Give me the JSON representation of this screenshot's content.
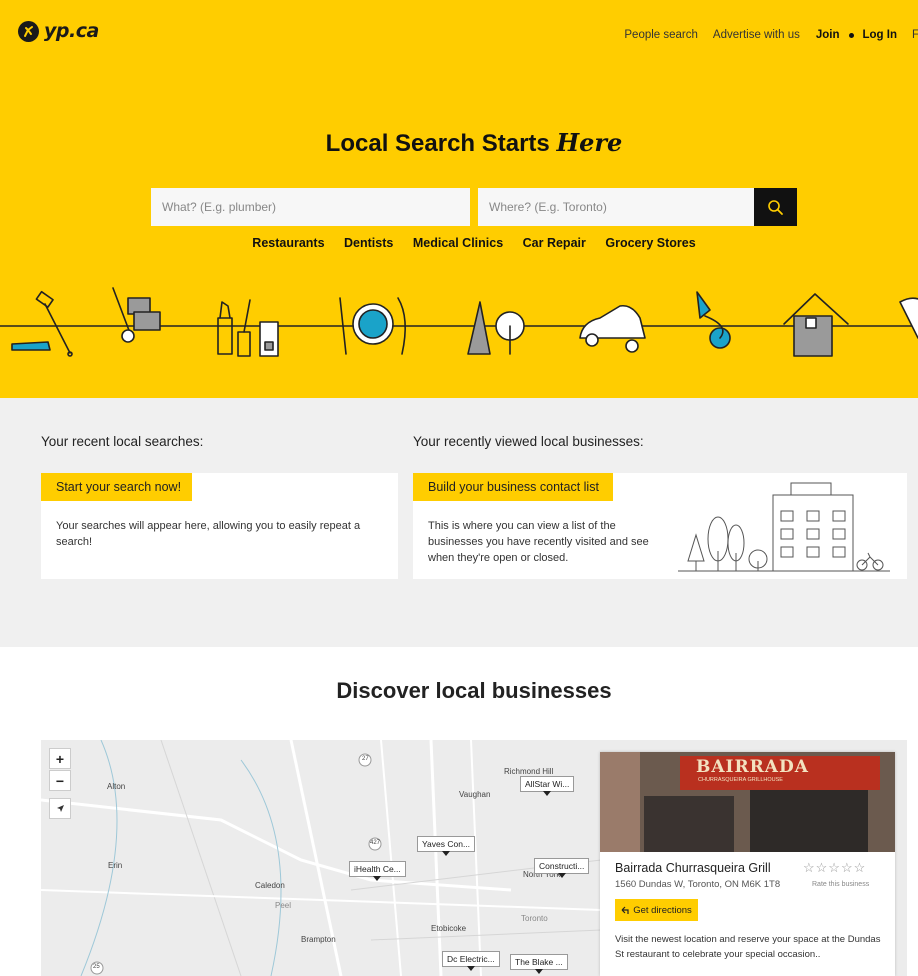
{
  "header": {
    "logo_text": "yp.ca",
    "nav": {
      "people_search": "People search",
      "advertise": "Advertise with us",
      "join": "Join",
      "login": "Log In",
      "clipped": "F"
    }
  },
  "hero": {
    "headline": "Local Search Starts",
    "headline_emphasis": "Here",
    "what_placeholder": "What? (E.g. plumber)",
    "where_placeholder": "Where? (E.g. Toronto)",
    "quick_links": [
      "Restaurants",
      "Dentists",
      "Medical Clinics",
      "Car Repair",
      "Grocery Stores"
    ]
  },
  "recent": {
    "searches_label": "Your recent local searches:",
    "searches_tag": "Start your search now!",
    "searches_text": "Your searches will appear here, allowing you to easily repeat a search!",
    "viewed_label": "Your recently viewed local businesses:",
    "viewed_tag": "Build your business contact list",
    "viewed_text": "This is where you can view a list of the businesses you have recently visited and see when they're open or closed."
  },
  "discover": {
    "title": "Discover local businesses",
    "zoom_in": "+",
    "zoom_out": "−",
    "map_places": [
      "Alton",
      "Richmond Hill",
      "Vaughan",
      "Erin",
      "Caledon",
      "Peel",
      "Brampton",
      "Etobicoke",
      "Toronto",
      "North York"
    ],
    "route_numbers": [
      "27",
      "427",
      "25"
    ],
    "map_pins": [
      "AllStar Wi...",
      "Yaves Con...",
      "iHealth Ce...",
      "Constructi...",
      "Dc Electric...",
      "The Blake ..."
    ],
    "business": {
      "sign_text": "BAIRRADA",
      "sign_subtext": "CHURRASQUEIRA GRILLHOUSE",
      "name": "Bairrada Churrasqueira Grill",
      "address": "1560 Dundas W, Toronto, ON M6K 1T8",
      "stars": "☆☆☆☆☆",
      "rate_label": "Rate this business",
      "directions_label": "Get directions",
      "description": "Visit the newest location and reserve your space at the Dundas St restaurant to celebrate your special occasion.."
    }
  },
  "colors": {
    "brand_yellow": "#ffcd00",
    "dark": "#111111",
    "teal_accent": "#1aa3c9"
  }
}
